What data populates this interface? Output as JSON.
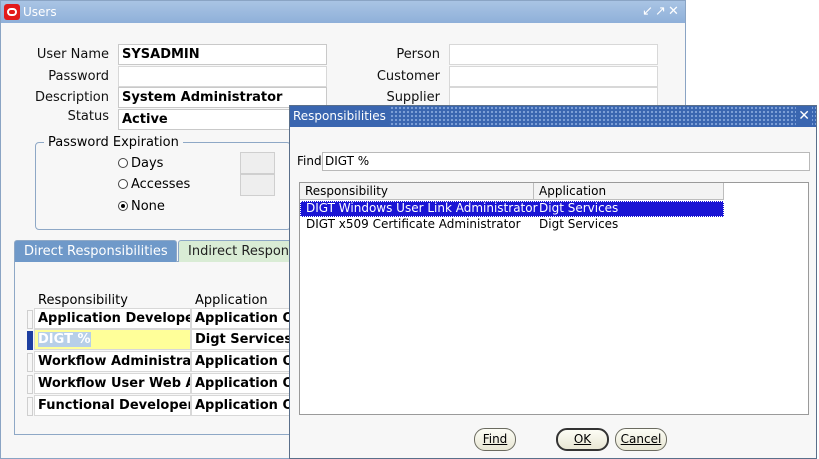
{
  "users_window": {
    "title": "Users",
    "controls": [
      "↙",
      "↗",
      "✕"
    ],
    "labels": {
      "user_name": "User Name",
      "password": "Password",
      "description": "Description",
      "status": "Status",
      "person": "Person",
      "customer": "Customer",
      "supplier": "Supplier"
    },
    "values": {
      "user_name": "SYSADMIN",
      "password": "",
      "description": "System Administrator",
      "status": "Active",
      "person": "",
      "customer": "",
      "supplier": ""
    },
    "password_expiration": {
      "legend": "Password Expiration",
      "options": [
        "Days",
        "Accesses",
        "None"
      ],
      "selected": "None"
    },
    "tabs": [
      "Direct Responsibilities",
      "Indirect Respons"
    ],
    "active_tab": "Direct Responsibilities",
    "table": {
      "headers": [
        "Responsibility",
        "Application"
      ],
      "rows": [
        {
          "responsibility": "Application Developer",
          "application": "Application Ob"
        },
        {
          "responsibility": "DIGT %",
          "application": "Digt Services"
        },
        {
          "responsibility": "Workflow Administrator",
          "application": "Application Ob"
        },
        {
          "responsibility": "Workflow User Web A",
          "application": "Application Ob"
        },
        {
          "responsibility": "Functional Developer",
          "application": "Application Ob"
        }
      ],
      "current_row": 1
    }
  },
  "lov": {
    "title": "Responsibilities",
    "find_label": "Find",
    "find_value": "DIGT %",
    "headers": [
      "Responsibility",
      "Application"
    ],
    "rows": [
      {
        "responsibility": "DIGT Windows User Link Administrator",
        "application": "Digt Services"
      },
      {
        "responsibility": "DIGT x509 Certificate Administrator",
        "application": "Digt Services"
      }
    ],
    "selected_row": 0,
    "buttons": {
      "find": "Find",
      "ok": "OK",
      "cancel": "Cancel"
    },
    "colors": {
      "selection": "#1a14d4",
      "title_bar": "#3a66b0"
    }
  }
}
